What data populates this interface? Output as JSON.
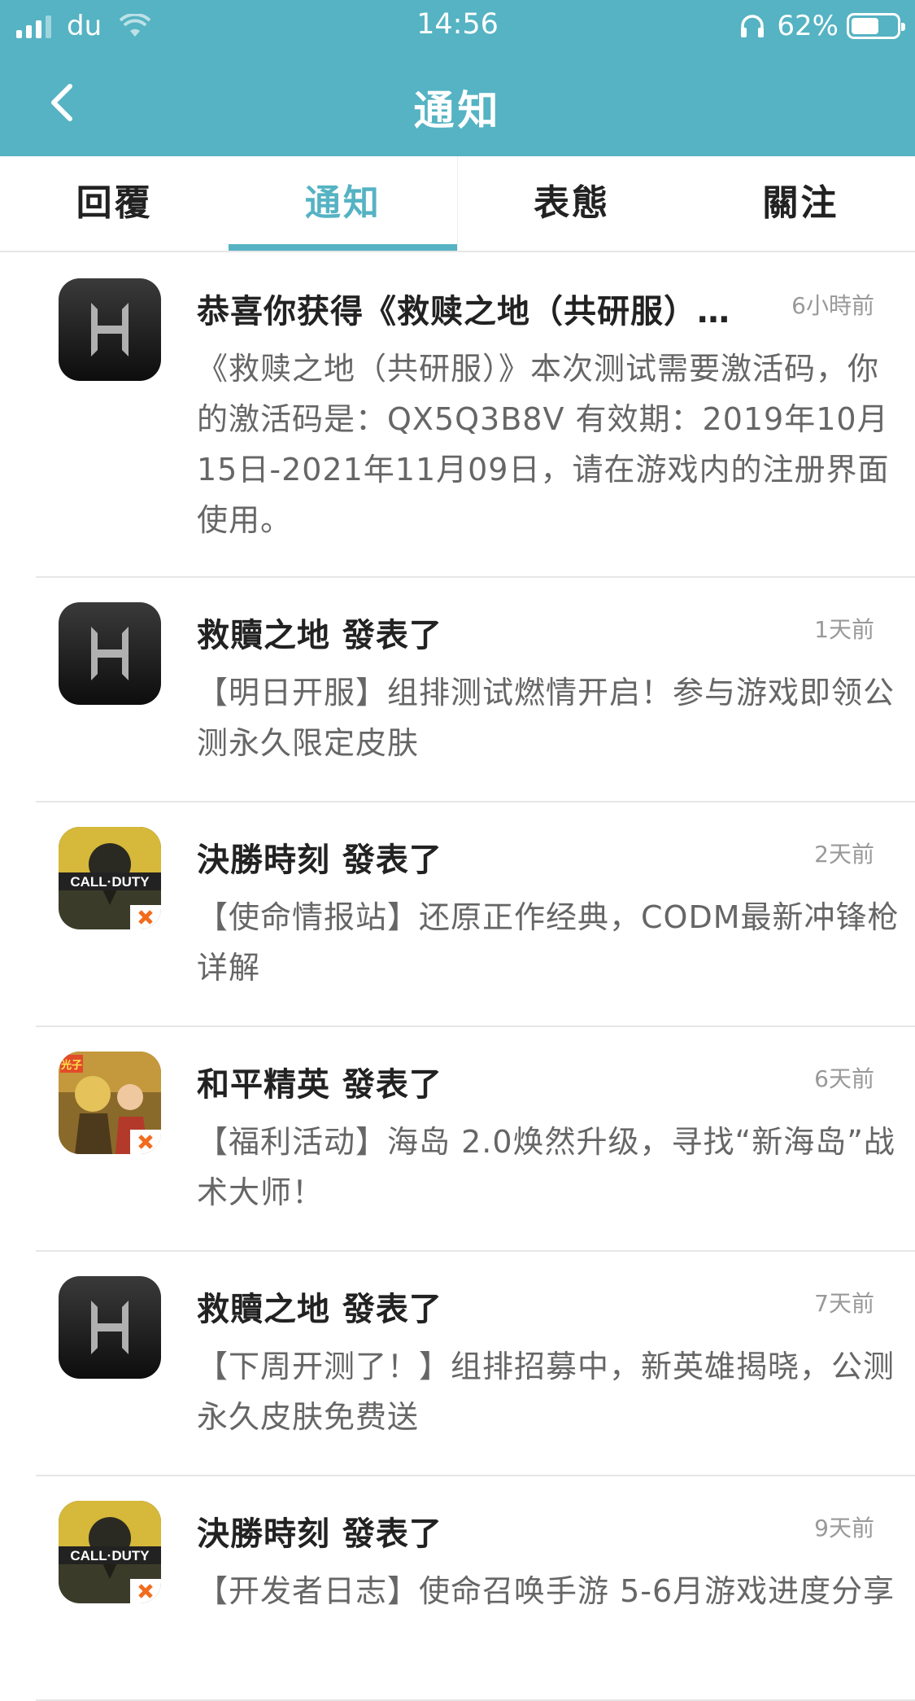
{
  "status_bar": {
    "carrier": "du",
    "time": "14:56",
    "battery": "62%",
    "battery_level": 0.62
  },
  "nav": {
    "title": "通知",
    "back_icon": "chevron-left-icon"
  },
  "tabs": [
    {
      "label": "回覆",
      "active": false
    },
    {
      "label": "通知",
      "active": true
    },
    {
      "label": "表態",
      "active": false
    },
    {
      "label": "關注",
      "active": false
    }
  ],
  "notifications": [
    {
      "avatar": "hideout-app-icon",
      "title": "恭喜你获得《救赎之地（共研服）…",
      "time": "6小時前",
      "body": "《救赎之地（共研服）》本次测试需要激活码，你的激活码是：QX5Q3B8V 有效期：2019年10月15日-2021年11月09日，请在游戏内的注册界面使用。"
    },
    {
      "avatar": "hideout-app-icon",
      "title": "救贖之地 發表了",
      "time": "1天前",
      "body": "【明日开服】组排测试燃情开启！参与游戏即领公测永久限定皮肤"
    },
    {
      "avatar": "call-of-duty-app-icon",
      "avatar_text": "CALL·DUTY",
      "title": "決勝時刻 發表了",
      "time": "2天前",
      "body": "【使命情报站】还原正作经典，CODM最新冲锋枪详解"
    },
    {
      "avatar": "peacekeeper-elite-app-icon",
      "avatar_text": "光子",
      "title": "和平精英 發表了",
      "time": "6天前",
      "body": "【福利活动】海岛 2.0焕然升级，寻找“新海岛”战术大师！"
    },
    {
      "avatar": "hideout-app-icon",
      "title": "救贖之地 發表了",
      "time": "7天前",
      "body": "【下周开测了！】组排招募中，新英雄揭晓，公测永久皮肤免费送"
    },
    {
      "avatar": "call-of-duty-app-icon",
      "avatar_text": "CALL·DUTY",
      "title": "決勝時刻 發表了",
      "time": "9天前",
      "body": "【开发者日志】使命召唤手游 5-6月游戏进度分享"
    }
  ],
  "colors": {
    "accent": "#55b3c3",
    "title_text": "#222222",
    "body_text": "#666666",
    "time_text": "#999999"
  }
}
